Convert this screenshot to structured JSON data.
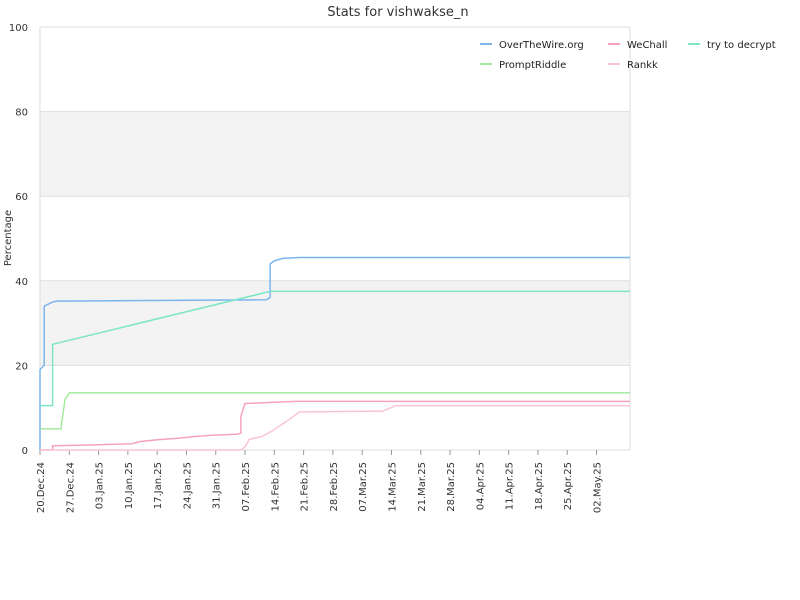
{
  "chart_data": {
    "type": "line",
    "title": "Stats for vishwakse_n",
    "xlabel": "",
    "ylabel": "Percentage",
    "ylim": [
      0,
      100
    ],
    "yticks": [
      0,
      20,
      40,
      60,
      80,
      100
    ],
    "xlim": [
      "2024-12-20",
      "2025-05-10"
    ],
    "xticks": [
      {
        "label": "20.Dec.24",
        "date": "2024-12-20"
      },
      {
        "label": "27.Dec.24",
        "date": "2024-12-27"
      },
      {
        "label": "03.Jan.25",
        "date": "2025-01-03"
      },
      {
        "label": "10.Jan.25",
        "date": "2025-01-10"
      },
      {
        "label": "17.Jan.25",
        "date": "2025-01-17"
      },
      {
        "label": "24.Jan.25",
        "date": "2025-01-24"
      },
      {
        "label": "31.Jan.25",
        "date": "2025-01-31"
      },
      {
        "label": "07.Feb.25",
        "date": "2025-02-07"
      },
      {
        "label": "14.Feb.25",
        "date": "2025-02-14"
      },
      {
        "label": "21.Feb.25",
        "date": "2025-02-21"
      },
      {
        "label": "28.Feb.25",
        "date": "2025-02-28"
      },
      {
        "label": "07.Mar.25",
        "date": "2025-03-07"
      },
      {
        "label": "14.Mar.25",
        "date": "2025-03-14"
      },
      {
        "label": "21.Mar.25",
        "date": "2025-03-21"
      },
      {
        "label": "28.Mar.25",
        "date": "2025-03-28"
      },
      {
        "label": "04.Apr.25",
        "date": "2025-04-04"
      },
      {
        "label": "11.Apr.25",
        "date": "2025-04-11"
      },
      {
        "label": "18.Apr.25",
        "date": "2025-04-18"
      },
      {
        "label": "25.Apr.25",
        "date": "2025-04-25"
      },
      {
        "label": "02.May.25",
        "date": "2025-05-02"
      }
    ],
    "grid": true,
    "legend_position": "top-right",
    "series": [
      {
        "name": "OverTheWire.org",
        "color": "#7cb5ec",
        "points": [
          [
            "2024-12-20",
            0
          ],
          [
            "2024-12-20",
            19
          ],
          [
            "2024-12-21",
            20
          ],
          [
            "2024-12-21",
            30
          ],
          [
            "2024-12-21",
            34
          ],
          [
            "2024-12-22",
            34.5
          ],
          [
            "2024-12-23",
            35
          ],
          [
            "2024-12-24",
            35.2
          ],
          [
            "2025-01-07",
            35.3
          ],
          [
            "2025-02-12",
            35.5
          ],
          [
            "2025-02-13",
            36
          ],
          [
            "2025-02-13",
            44
          ],
          [
            "2025-02-14",
            44.7
          ],
          [
            "2025-02-16",
            45.3
          ],
          [
            "2025-02-20",
            45.5
          ],
          [
            "2025-05-10",
            45.5
          ]
        ]
      },
      {
        "name": "WeChall",
        "color": "#f7a1c0",
        "points": [
          [
            "2024-12-20",
            0
          ],
          [
            "2024-12-23",
            0
          ],
          [
            "2024-12-23",
            1
          ],
          [
            "2025-01-02",
            1.2
          ],
          [
            "2025-01-11",
            1.5
          ],
          [
            "2025-01-13",
            2
          ],
          [
            "2025-01-17",
            2.4
          ],
          [
            "2025-01-22",
            2.8
          ],
          [
            "2025-01-26",
            3.2
          ],
          [
            "2025-01-30",
            3.5
          ],
          [
            "2025-02-05",
            3.7
          ],
          [
            "2025-02-06",
            4
          ],
          [
            "2025-02-06",
            8
          ],
          [
            "2025-02-07",
            11
          ],
          [
            "2025-02-12",
            11.2
          ],
          [
            "2025-02-19",
            11.5
          ],
          [
            "2025-05-10",
            11.5
          ]
        ]
      },
      {
        "name": "try to decrypt",
        "color": "#7ee4c8",
        "points": [
          [
            "2024-12-20",
            10.5
          ],
          [
            "2024-12-23",
            10.5
          ],
          [
            "2024-12-23",
            25
          ],
          [
            "2025-02-13",
            37.5
          ],
          [
            "2025-05-10",
            37.5
          ]
        ]
      },
      {
        "name": "PromptRiddle",
        "color": "#a6e9a0",
        "points": [
          [
            "2024-12-20",
            5
          ],
          [
            "2024-12-25",
            5
          ],
          [
            "2024-12-26",
            12
          ],
          [
            "2024-12-27",
            13.5
          ],
          [
            "2025-05-10",
            13.5
          ]
        ]
      },
      {
        "name": "Rankk",
        "color": "#f8c6d2",
        "points": [
          [
            "2024-12-20",
            0
          ],
          [
            "2025-02-06",
            0
          ],
          [
            "2025-02-07",
            0.7
          ],
          [
            "2025-02-08",
            2.5
          ],
          [
            "2025-02-11",
            3.2
          ],
          [
            "2025-02-13",
            4.2
          ],
          [
            "2025-02-15",
            5.5
          ],
          [
            "2025-02-18",
            7.5
          ],
          [
            "2025-02-20",
            9
          ],
          [
            "2025-03-12",
            9.2
          ],
          [
            "2025-03-15",
            10.5
          ],
          [
            "2025-05-10",
            10.5
          ]
        ]
      }
    ]
  }
}
